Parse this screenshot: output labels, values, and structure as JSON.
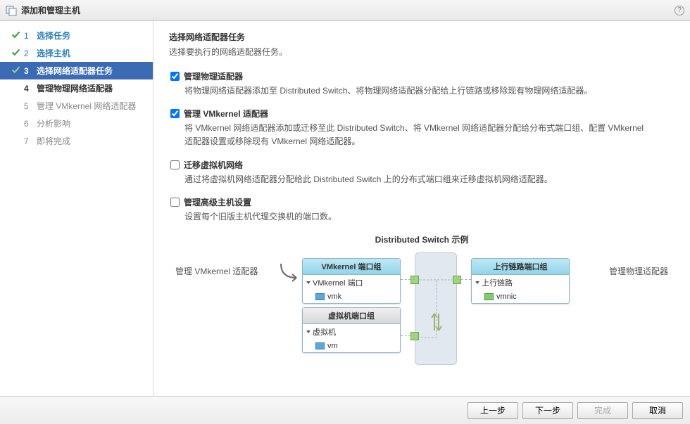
{
  "title": "添加和管理主机",
  "steps": [
    {
      "num": "1",
      "label": "选择任务",
      "state": "done"
    },
    {
      "num": "2",
      "label": "选择主机",
      "state": "done"
    },
    {
      "num": "3",
      "label": "选择网络适配器任务",
      "state": "current"
    },
    {
      "num": "4",
      "label": "管理物理网络适配器",
      "state": "pending_bold"
    },
    {
      "num": "5",
      "label": "管理 VMkernel 网络适配器",
      "state": "pending"
    },
    {
      "num": "6",
      "label": "分析影响",
      "state": "pending"
    },
    {
      "num": "7",
      "label": "即将完成",
      "state": "pending"
    }
  ],
  "main": {
    "title": "选择网络适配器任务",
    "sub": "选择要执行的网络适配器任务。"
  },
  "options": [
    {
      "checked": true,
      "label": "管理物理适配器",
      "desc": "将物理网络适配器添加至 Distributed Switch、将物理网络适配器分配给上行链路或移除现有物理网络适配器。"
    },
    {
      "checked": true,
      "label": "管理 VMkernel 适配器",
      "desc": "将 VMkernel 网络适配器添加或迁移至此 Distributed Switch、将 VMkernel 网络适配器分配给分布式端口组、配置 VMkernel 适配器设置或移除现有 VMkernel 网络适配器。"
    },
    {
      "checked": false,
      "label": "迁移虚拟机网络",
      "desc": "通过将虚拟机网络适配器分配给此 Distributed Switch 上的分布式端口组来迁移虚拟机网络适配器。"
    },
    {
      "checked": false,
      "label": "管理高级主机设置",
      "desc": "设置每个旧版主机代理交换机的端口数。"
    }
  ],
  "diagram": {
    "title": "Distributed Switch 示例",
    "left_label": "管理 VMkernel 适配器",
    "right_label": "管理物理适配器",
    "vmk_header": "VMkernel 端口组",
    "vmk_row1": "VMkernel 端口",
    "vmk_row2": "vmk",
    "vm_header": "虚拟机端口组",
    "vm_row1": "虚拟机",
    "vm_row2": "vm",
    "uplink_header": "上行链路端口组",
    "uplink_row1": "上行链路",
    "uplink_row2": "vmnic"
  },
  "buttons": {
    "back": "上一步",
    "next": "下一步",
    "finish": "完成",
    "cancel": "取消"
  }
}
